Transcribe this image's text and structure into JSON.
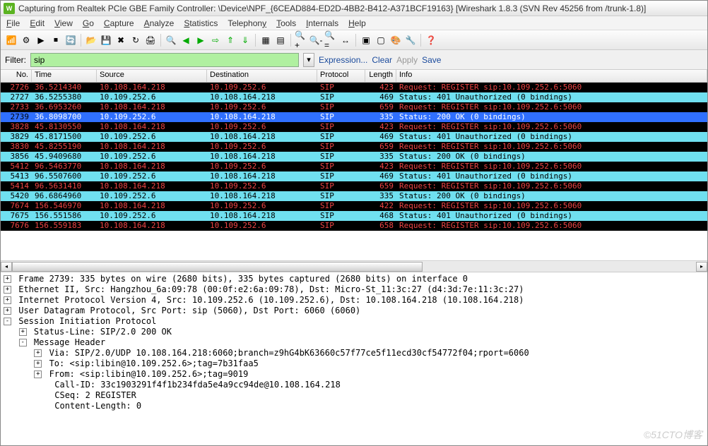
{
  "title": "Capturing from Realtek PCIe GBE Family Controller: \\Device\\NPF_{6CEAD884-ED2D-4BB2-B412-A371BCF19163}   [Wireshark 1.8.3  (SVN Rev 45256 from /trunk-1.8)]",
  "menus": [
    "File",
    "Edit",
    "View",
    "Go",
    "Capture",
    "Analyze",
    "Statistics",
    "Telephony",
    "Tools",
    "Internals",
    "Help"
  ],
  "filter": {
    "label": "Filter:",
    "value": "sip",
    "expression": "Expression...",
    "clear": "Clear",
    "apply": "Apply",
    "save": "Save"
  },
  "columns": {
    "no": "No.",
    "time": "Time",
    "src": "Source",
    "dst": "Destination",
    "proto": "Protocol",
    "len": "Length",
    "info": "Info"
  },
  "packets": [
    {
      "cls": "black",
      "no": "2726",
      "time": "36.5214340",
      "src": "10.108.164.218",
      "dst": "10.109.252.6",
      "proto": "SIP",
      "len": "423",
      "info": "Request: REGISTER sip:10.109.252.6:5060"
    },
    {
      "cls": "cyan",
      "no": "2727",
      "time": "36.5255380",
      "src": "10.109.252.6",
      "dst": "10.108.164.218",
      "proto": "SIP",
      "len": "469",
      "info": "Status: 401 Unauthorized    (0 bindings)"
    },
    {
      "cls": "black",
      "no": "2733",
      "time": "36.6953260",
      "src": "10.108.164.218",
      "dst": "10.109.252.6",
      "proto": "SIP",
      "len": "659",
      "info": "Request: REGISTER sip:10.109.252.6:5060"
    },
    {
      "cls": "blue",
      "no": "2739",
      "time": "36.8098700",
      "src": "10.109.252.6",
      "dst": "10.108.164.218",
      "proto": "SIP",
      "len": "335",
      "info": "Status: 200 OK    (0 bindings)"
    },
    {
      "cls": "black",
      "no": "3828",
      "time": "45.8130550",
      "src": "10.108.164.218",
      "dst": "10.109.252.6",
      "proto": "SIP",
      "len": "423",
      "info": "Request: REGISTER sip:10.109.252.6:5060"
    },
    {
      "cls": "cyan",
      "no": "3829",
      "time": "45.8171500",
      "src": "10.109.252.6",
      "dst": "10.108.164.218",
      "proto": "SIP",
      "len": "469",
      "info": "Status: 401 Unauthorized    (0 bindings)"
    },
    {
      "cls": "black",
      "no": "3830",
      "time": "45.8255190",
      "src": "10.108.164.218",
      "dst": "10.109.252.6",
      "proto": "SIP",
      "len": "659",
      "info": "Request: REGISTER sip:10.109.252.6:5060"
    },
    {
      "cls": "cyan",
      "no": "3856",
      "time": "45.9409680",
      "src": "10.109.252.6",
      "dst": "10.108.164.218",
      "proto": "SIP",
      "len": "335",
      "info": "Status: 200 OK    (0 bindings)"
    },
    {
      "cls": "black",
      "no": "5412",
      "time": "96.5463770",
      "src": "10.108.164.218",
      "dst": "10.109.252.6",
      "proto": "SIP",
      "len": "423",
      "info": "Request: REGISTER sip:10.109.252.6:5060"
    },
    {
      "cls": "cyan",
      "no": "5413",
      "time": "96.5507600",
      "src": "10.109.252.6",
      "dst": "10.108.164.218",
      "proto": "SIP",
      "len": "469",
      "info": "Status: 401 Unauthorized    (0 bindings)"
    },
    {
      "cls": "black",
      "no": "5414",
      "time": "96.5631410",
      "src": "10.108.164.218",
      "dst": "10.109.252.6",
      "proto": "SIP",
      "len": "659",
      "info": "Request: REGISTER sip:10.109.252.6:5060"
    },
    {
      "cls": "cyan",
      "no": "5420",
      "time": "96.6864960",
      "src": "10.109.252.6",
      "dst": "10.108.164.218",
      "proto": "SIP",
      "len": "335",
      "info": "Status: 200 OK    (0 bindings)"
    },
    {
      "cls": "black",
      "no": "7674",
      "time": "156.546970",
      "src": "10.108.164.218",
      "dst": "10.109.252.6",
      "proto": "SIP",
      "len": "422",
      "info": "Request: REGISTER sip:10.109.252.6:5060"
    },
    {
      "cls": "cyan",
      "no": "7675",
      "time": "156.551586",
      "src": "10.109.252.6",
      "dst": "10.108.164.218",
      "proto": "SIP",
      "len": "468",
      "info": "Status: 401 Unauthorized    (0 bindings)"
    },
    {
      "cls": "black",
      "no": "7676",
      "time": "156.559183",
      "src": "10.108.164.218",
      "dst": "10.109.252.6",
      "proto": "SIP",
      "len": "658",
      "info": "Request: REGISTER sip:10.109.252.6:5060"
    }
  ],
  "details": [
    {
      "pad": 0,
      "exp": "+",
      "text": "Frame 2739: 335 bytes on wire (2680 bits), 335 bytes captured (2680 bits) on interface 0"
    },
    {
      "pad": 0,
      "exp": "+",
      "text": "Ethernet II, Src: Hangzhou_6a:09:78 (00:0f:e2:6a:09:78), Dst: Micro-St_11:3c:27 (d4:3d:7e:11:3c:27)"
    },
    {
      "pad": 0,
      "exp": "+",
      "text": "Internet Protocol Version 4, Src: 10.109.252.6 (10.109.252.6), Dst: 10.108.164.218 (10.108.164.218)"
    },
    {
      "pad": 0,
      "exp": "+",
      "text": "User Datagram Protocol, Src Port: sip (5060), Dst Port: 6060 (6060)"
    },
    {
      "pad": 0,
      "exp": "-",
      "text": "Session Initiation Protocol"
    },
    {
      "pad": 1,
      "exp": "+",
      "text": "Status-Line: SIP/2.0 200 OK"
    },
    {
      "pad": 1,
      "exp": "-",
      "text": "Message Header"
    },
    {
      "pad": 2,
      "exp": "+",
      "text": "Via: SIP/2.0/UDP 10.108.164.218:6060;branch=z9hG4bK63660c57f77ce5f11ecd30cf54772f04;rport=6060"
    },
    {
      "pad": 2,
      "exp": "+",
      "text": "To: <sip:libin@10.109.252.6>;tag=7b31faa5"
    },
    {
      "pad": 2,
      "exp": "+",
      "text": "From: <sip:libin@10.109.252.6>;tag=9019"
    },
    {
      "pad": 2,
      "exp": "",
      "text": "Call-ID: 33c1903291f4f1b234fda5e4a9cc94de@10.108.164.218"
    },
    {
      "pad": 2,
      "exp": "",
      "text": "CSeq: 2 REGISTER"
    },
    {
      "pad": 2,
      "exp": "",
      "text": "Content-Length: 0"
    }
  ],
  "watermark": "©51CTO博客"
}
